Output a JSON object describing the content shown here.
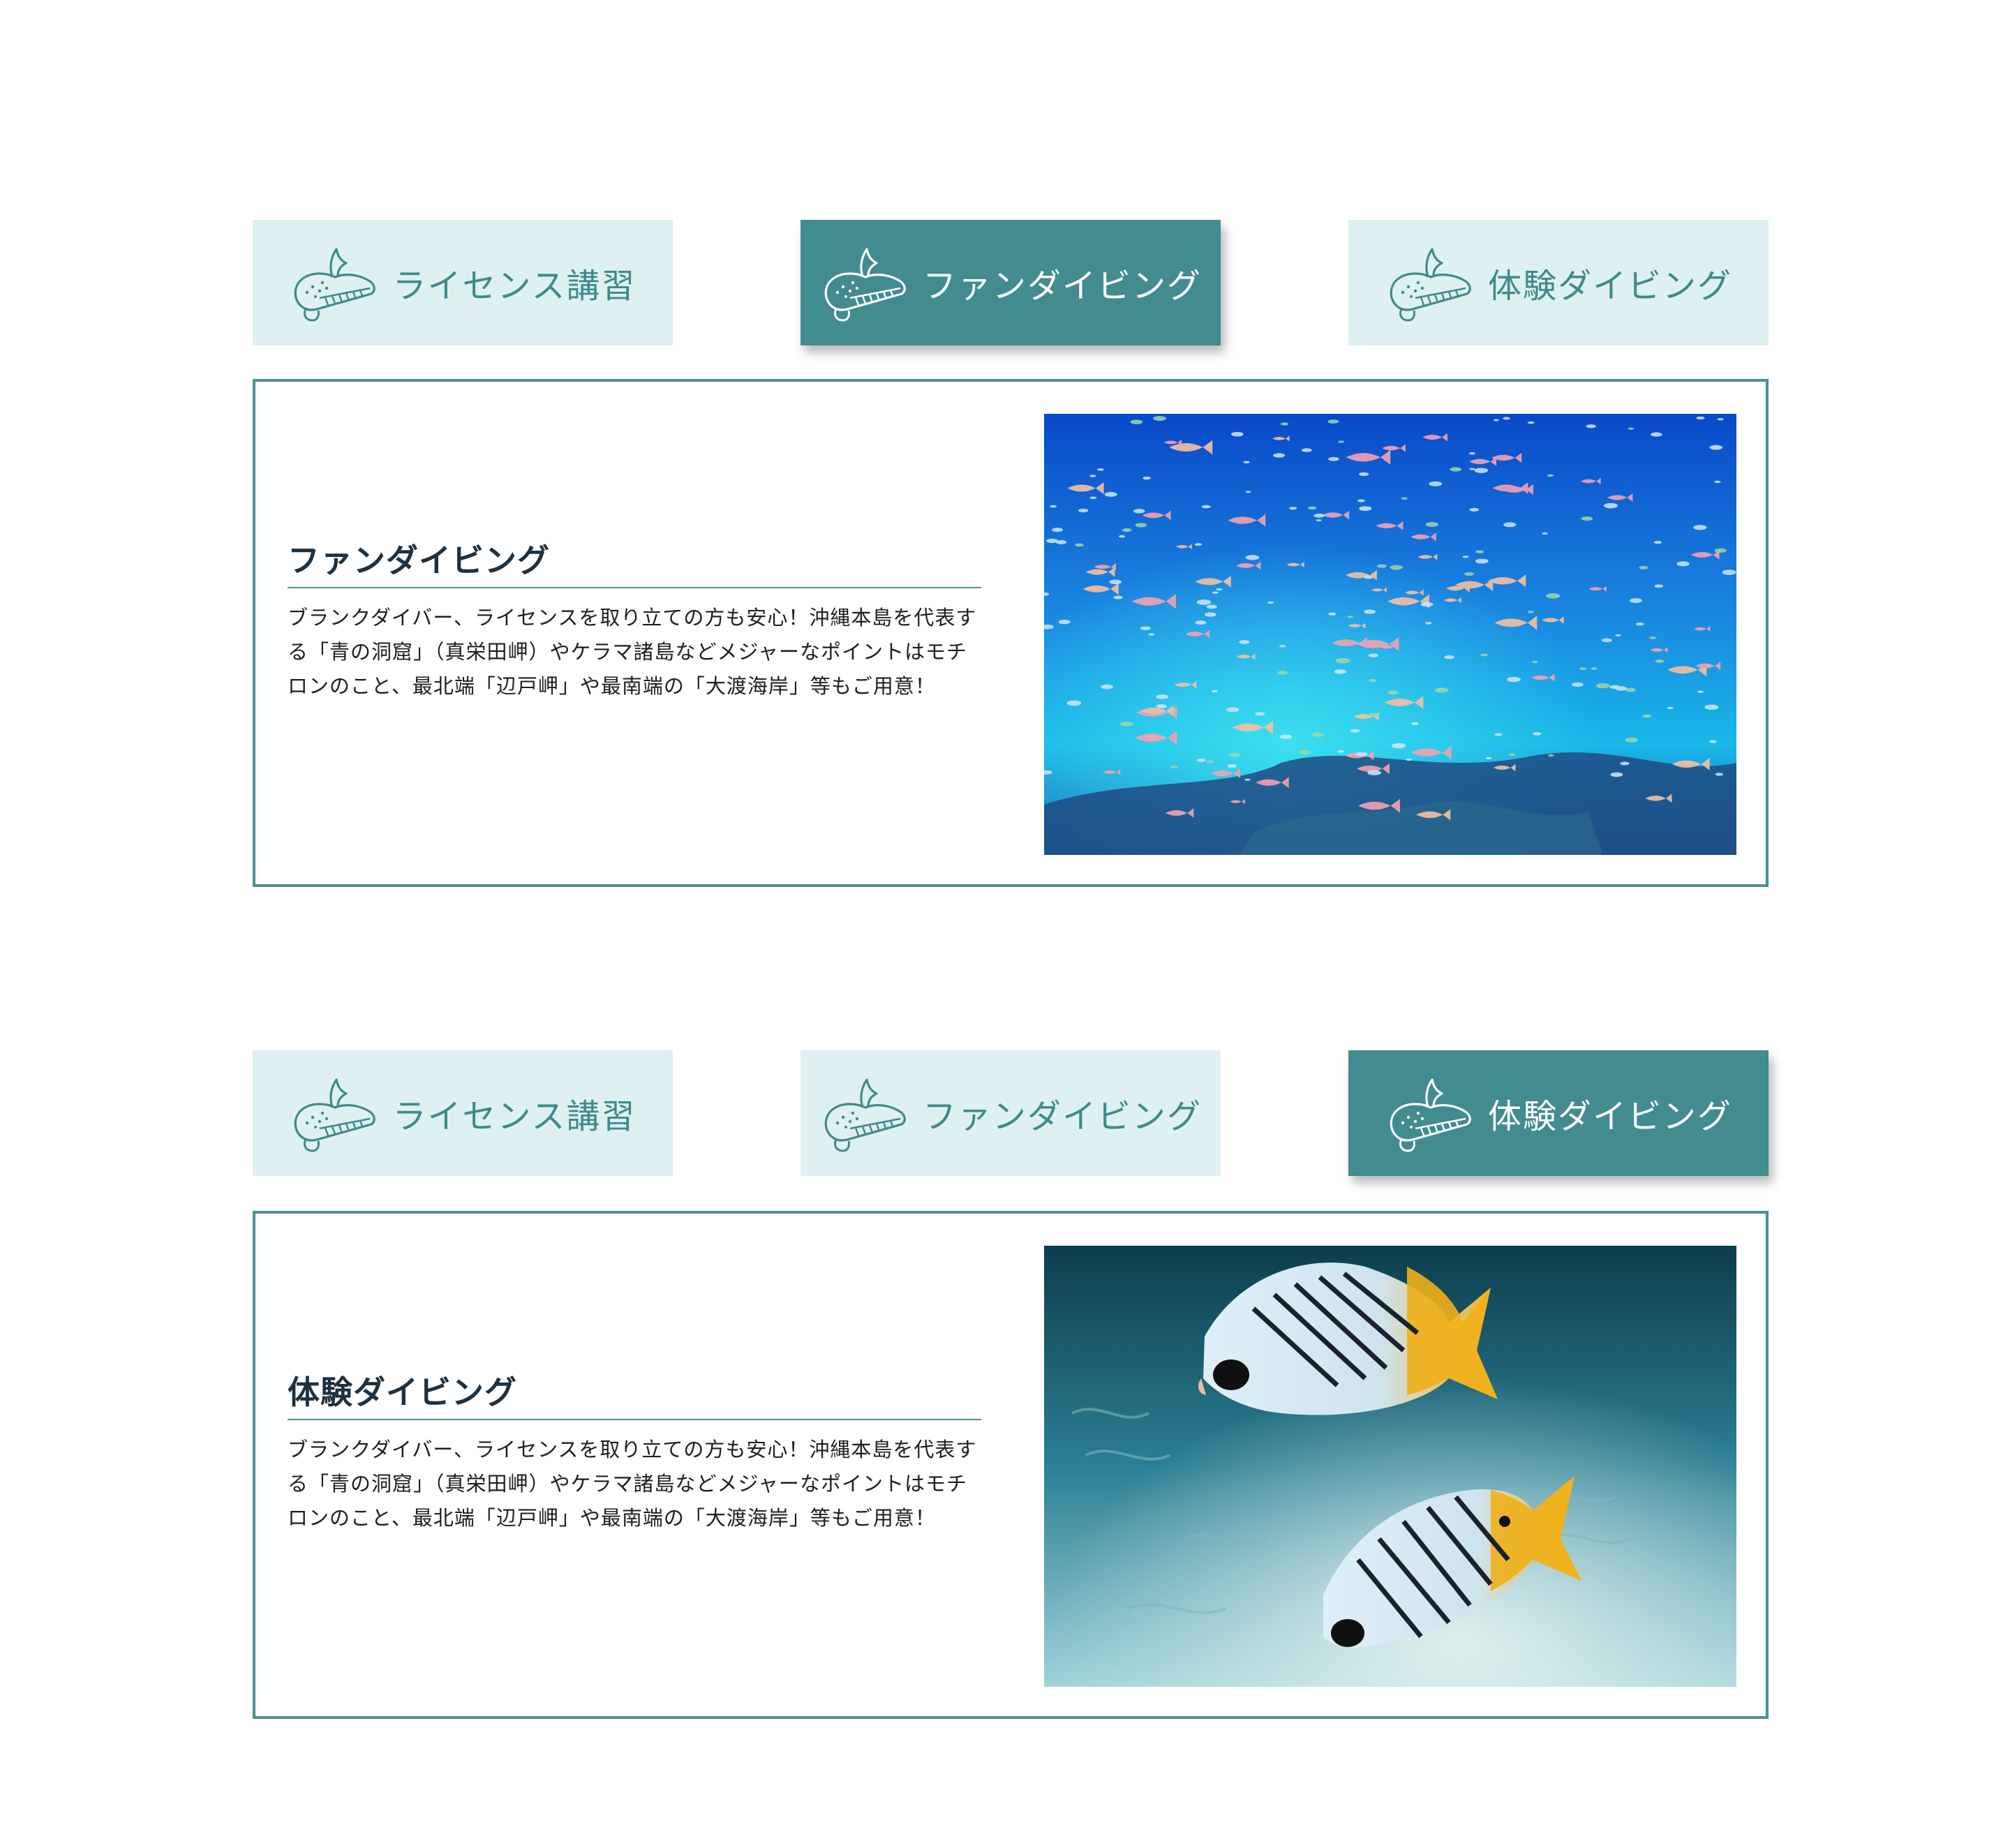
{
  "sections": [
    {
      "tabs": [
        {
          "label": "ライセンス講習",
          "active": false,
          "icon": "whale-icon"
        },
        {
          "label": "ファンダイビング",
          "active": true,
          "icon": "whale-icon"
        },
        {
          "label": "体験ダイビング",
          "active": false,
          "icon": "whale-icon"
        }
      ],
      "panel": {
        "title": "ファンダイビング",
        "description": "ブランクダイバー、ライセンスを取り立ての方も安心！沖縄本島を代表する「青の洞窟」（真栄田岬）やケラマ諸島などメジャーなポイントはモチロンのこと、最北端「辺戸岬」や最南端の「大渡海岸」等もご用意！",
        "image": "school-of-fish-photo"
      }
    },
    {
      "tabs": [
        {
          "label": "ライセンス講習",
          "active": false,
          "icon": "whale-icon"
        },
        {
          "label": "ファンダイビング",
          "active": false,
          "icon": "whale-icon"
        },
        {
          "label": "体験ダイビング",
          "active": true,
          "icon": "whale-icon"
        }
      ],
      "panel": {
        "title": "体験ダイビング",
        "description": "ブランクダイバー、ライセンスを取り立ての方も安心！沖縄本島を代表する「青の洞窟」（真栄田岬）やケラマ諸島などメジャーなポイントはモチロンのこと、最北端「辺戸岬」や最南端の「大渡海岸」等もご用意！",
        "image": "butterflyfish-photo"
      }
    }
  ],
  "colors": {
    "tab_bg": "#def0f1",
    "tab_active_bg": "#428b8e",
    "tab_text": "#3f8a8c",
    "panel_border": "#4a9092",
    "heading": "#1e3140"
  }
}
